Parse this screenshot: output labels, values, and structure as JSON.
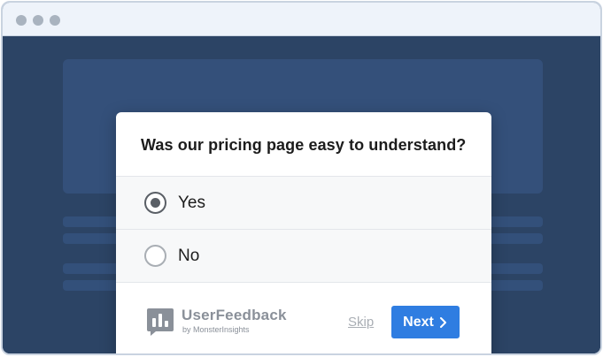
{
  "survey": {
    "question": "Was our pricing page easy to understand?",
    "options": [
      {
        "label": "Yes",
        "selected": true
      },
      {
        "label": "No",
        "selected": false
      }
    ],
    "skip_label": "Skip",
    "next_label": "Next"
  },
  "brand": {
    "name": "UserFeedback",
    "sub": "by MonsterInsights",
    "icon": "chart-bars-speech-icon"
  },
  "colors": {
    "accent": "#2f7de1",
    "backdrop": "#2c4465",
    "muted": "#8a9099"
  },
  "icons": {
    "next": "chevron-right-icon"
  }
}
